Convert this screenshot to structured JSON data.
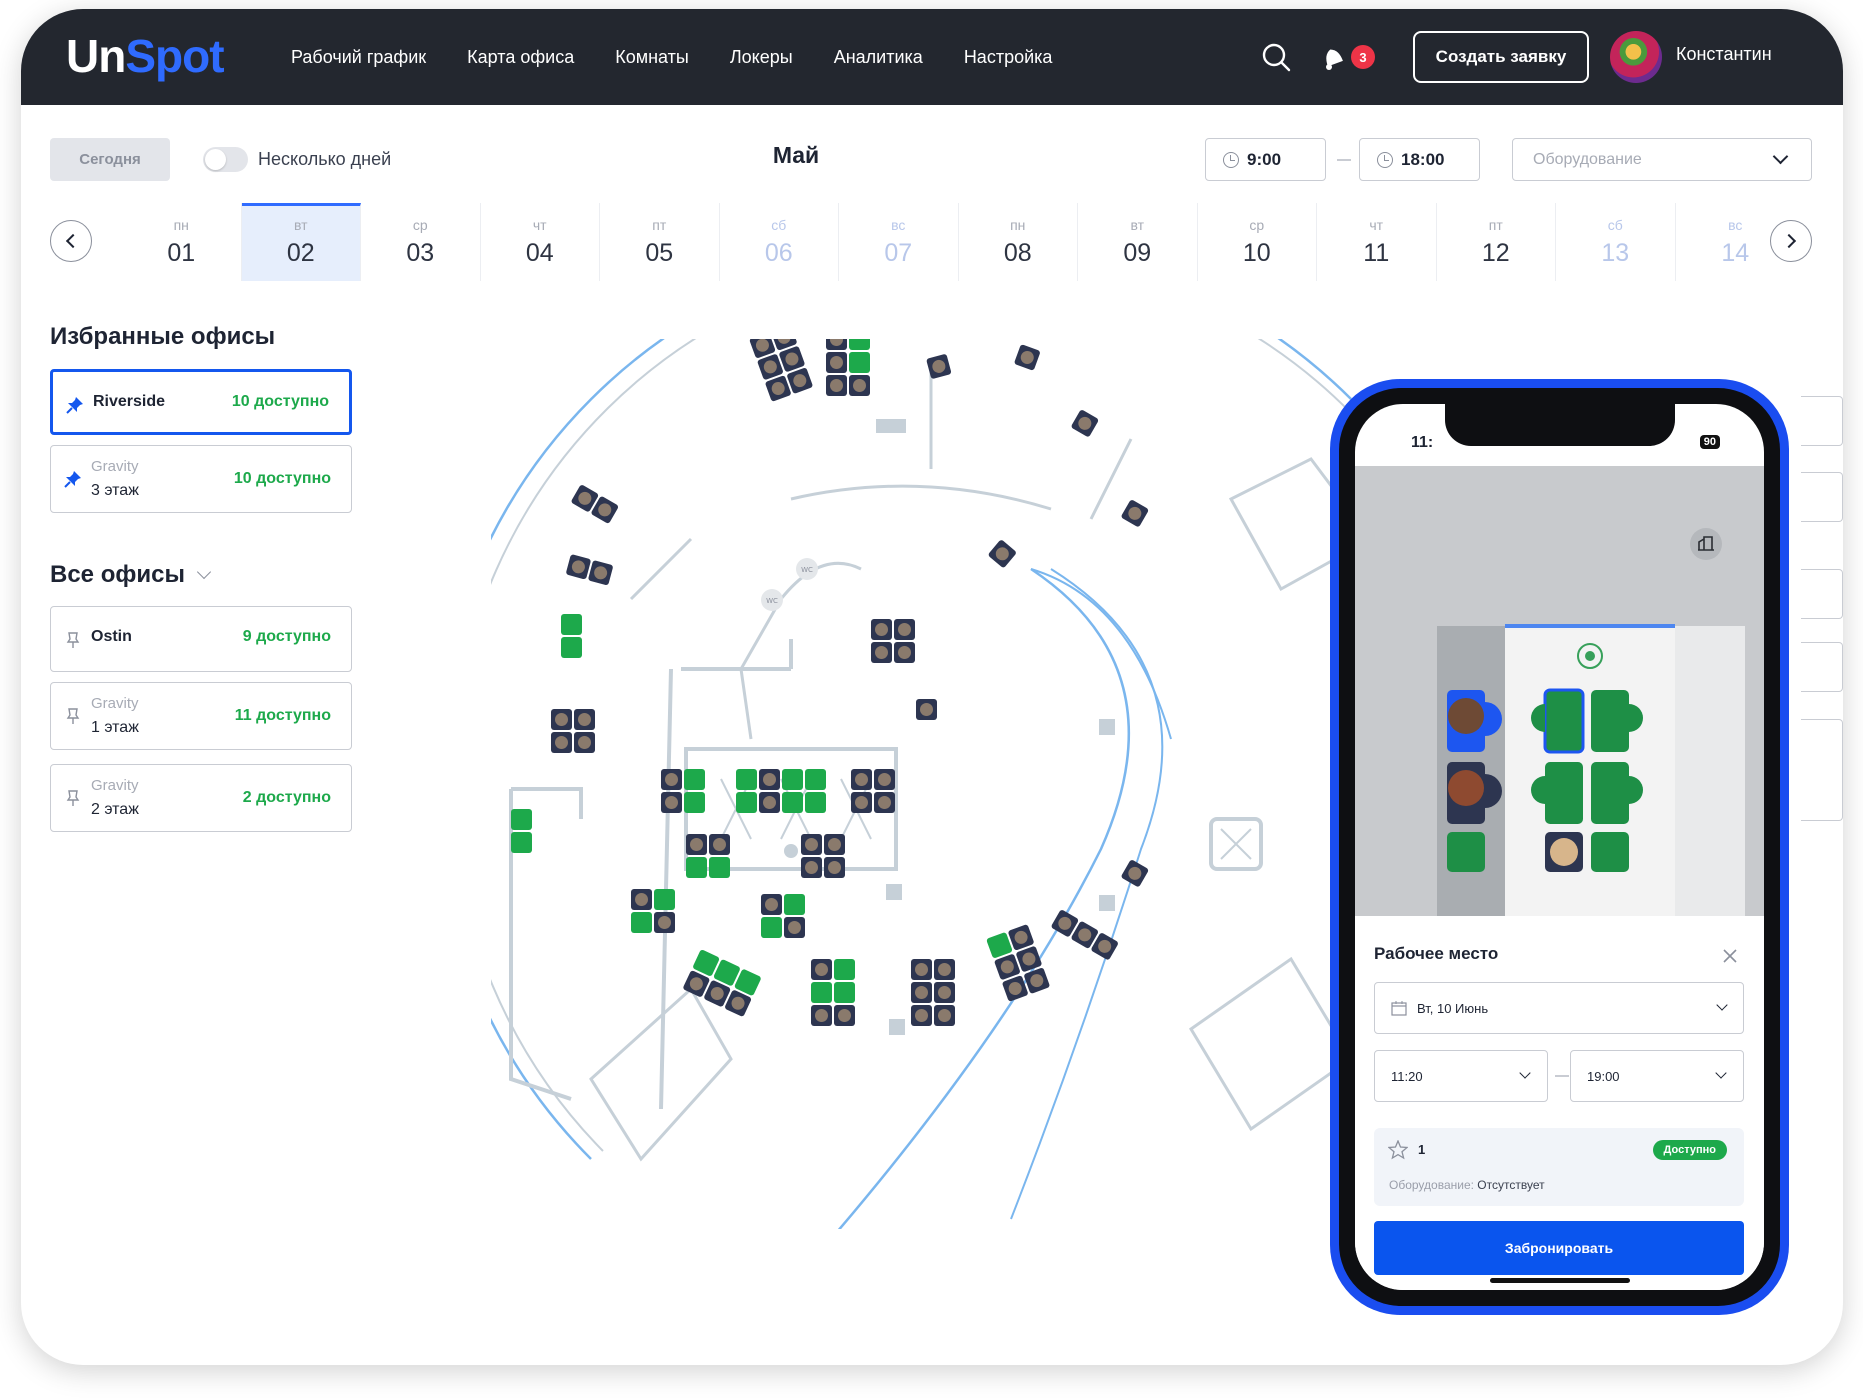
{
  "brand": {
    "part1": "Un",
    "part2": "Spot"
  },
  "nav": [
    "Рабочий график",
    "Карта офиса",
    "Комнаты",
    "Локеры",
    "Аналитика",
    "Настройка"
  ],
  "header": {
    "notifications": "3",
    "create_label": "Создать заявку",
    "user_name": "Константин"
  },
  "toolbar": {
    "today_label": "Сегодня",
    "multi_days_label": "Несколько дней",
    "month": "Май",
    "time_from": "9:00",
    "time_to": "18:00",
    "equipment_placeholder": "Оборудование"
  },
  "days": [
    {
      "dw": "пн",
      "dn": "01"
    },
    {
      "dw": "вт",
      "dn": "02"
    },
    {
      "dw": "ср",
      "dn": "03"
    },
    {
      "dw": "чт",
      "dn": "04"
    },
    {
      "dw": "пт",
      "dn": "05"
    },
    {
      "dw": "сб",
      "dn": "06"
    },
    {
      "dw": "вс",
      "dn": "07"
    },
    {
      "dw": "пн",
      "dn": "08"
    },
    {
      "dw": "вт",
      "dn": "09"
    },
    {
      "dw": "ср",
      "dn": "10"
    },
    {
      "dw": "чт",
      "dn": "11"
    },
    {
      "dw": "пт",
      "dn": "12"
    },
    {
      "dw": "сб",
      "dn": "13"
    },
    {
      "dw": "вс",
      "dn": "14"
    }
  ],
  "favorites": {
    "title": "Избранные офисы",
    "items": [
      {
        "name": "Riverside",
        "sub": "",
        "avail": "10 доступно"
      },
      {
        "name": "3 этаж",
        "sub": "Gravity",
        "avail": "10 доступно"
      }
    ]
  },
  "all_offices": {
    "title": "Все офисы",
    "items": [
      {
        "name": "Ostin",
        "sub": "",
        "avail": "9 доступно"
      },
      {
        "name": "1 этаж",
        "sub": "Gravity",
        "avail": "11 доступно"
      },
      {
        "name": "2 этаж",
        "sub": "Gravity",
        "avail": "2 доступно"
      }
    ]
  },
  "plan_labels": {
    "wc": "WC"
  },
  "colors": {
    "accent": "#2f6bff",
    "available": "#1da94b",
    "occupied": "#2d3550",
    "header": "#23272f"
  },
  "phone": {
    "time": "11:",
    "battery": "90",
    "sheet_title": "Рабочее место",
    "date_value": "Вт, 10 Июнь",
    "time_from": "11:20",
    "time_to": "19:00",
    "seat_number": "1",
    "status": "Доступно",
    "equipment_label": "Оборудование:",
    "equipment_value": "Отсутствует",
    "book_label": "Забронировать"
  }
}
